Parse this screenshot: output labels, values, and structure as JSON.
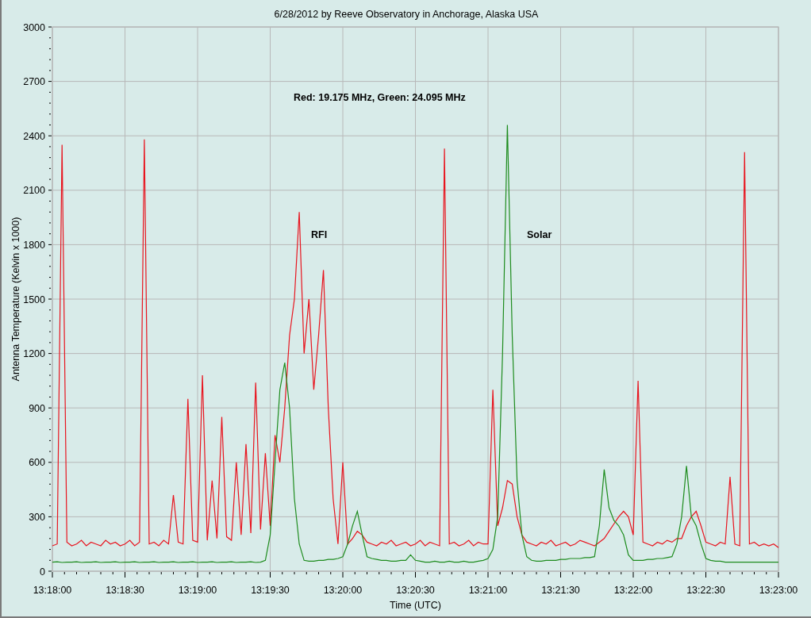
{
  "chart": {
    "chart_data": {
      "type": "line",
      "title": "6/28/2012  by  Reeve Observatory  in  Anchorage, Alaska  USA",
      "xlabel": "Time (UTC)",
      "ylabel": "Antenna Temperature (Kelvin x 1000)",
      "categories": [
        "13:18:00",
        null,
        null,
        null,
        null,
        null,
        null,
        null,
        null,
        null,
        null,
        null,
        null,
        null,
        null,
        "13:18:30",
        null,
        null,
        null,
        null,
        null,
        null,
        null,
        null,
        null,
        null,
        null,
        null,
        null,
        null,
        "13:19:00",
        null,
        null,
        null,
        null,
        null,
        null,
        null,
        null,
        null,
        null,
        null,
        null,
        null,
        null,
        "13:19:30",
        null,
        null,
        null,
        null,
        null,
        null,
        null,
        null,
        null,
        null,
        null,
        null,
        null,
        null,
        "13:20:00",
        null,
        null,
        null,
        null,
        null,
        null,
        null,
        null,
        null,
        null,
        null,
        null,
        null,
        null,
        "13:20:30",
        null,
        null,
        null,
        null,
        null,
        null,
        null,
        null,
        null,
        null,
        null,
        null,
        null,
        null,
        "13:21:00",
        null,
        null,
        null,
        null,
        null,
        null,
        null,
        null,
        null,
        null,
        null,
        null,
        null,
        null,
        "13:21:30",
        null,
        null,
        null,
        null,
        null,
        null,
        null,
        null,
        null,
        null,
        null,
        null,
        null,
        null,
        "13:22:00",
        null,
        null,
        null,
        null,
        null,
        null,
        null,
        null,
        null,
        null,
        null,
        null,
        null,
        null,
        "13:22:30",
        null,
        null,
        null,
        null,
        null,
        null,
        null,
        null,
        null,
        null,
        null,
        null,
        null,
        null,
        "13:23:00"
      ],
      "ylim": [
        0,
        3000
      ],
      "grid": true,
      "yticks": [
        0,
        300,
        600,
        900,
        1200,
        1500,
        1800,
        2100,
        2400,
        2700,
        3000
      ],
      "series": [
        {
          "color": "#e8141e",
          "values": [
            140,
            150,
            2350,
            160,
            140,
            150,
            170,
            140,
            160,
            150,
            140,
            170,
            150,
            160,
            140,
            150,
            170,
            140,
            160,
            2380,
            150,
            160,
            140,
            170,
            150,
            420,
            160,
            150,
            950,
            170,
            160,
            1080,
            170,
            500,
            180,
            850,
            190,
            170,
            600,
            200,
            700,
            210,
            1040,
            230,
            650,
            250,
            750,
            600,
            900,
            1300,
            1500,
            1980,
            1200,
            1500,
            1000,
            1300,
            1660,
            900,
            400,
            150,
            600,
            150,
            180,
            220,
            200,
            160,
            150,
            140,
            160,
            150,
            170,
            140,
            150,
            160,
            140,
            150,
            170,
            140,
            160,
            150,
            140,
            2330,
            150,
            160,
            140,
            150,
            170,
            140,
            160,
            150,
            150,
            1000,
            250,
            350,
            500,
            480,
            300,
            200,
            160,
            150,
            140,
            160,
            150,
            170,
            140,
            150,
            160,
            140,
            150,
            170,
            160,
            150,
            140,
            160,
            180,
            220,
            260,
            300,
            330,
            300,
            200,
            1050,
            160,
            150,
            140,
            160,
            150,
            170,
            160,
            180,
            180,
            250,
            300,
            330,
            250,
            160,
            150,
            140,
            160,
            150,
            520,
            150,
            140,
            2310,
            150,
            160,
            140,
            150,
            140,
            150,
            130
          ]
        },
        {
          "color": "#1e8c1e",
          "values": [
            50,
            52,
            48,
            50,
            50,
            52,
            48,
            50,
            50,
            52,
            48,
            50,
            50,
            52,
            48,
            50,
            50,
            52,
            48,
            50,
            50,
            52,
            48,
            50,
            50,
            52,
            48,
            50,
            50,
            52,
            48,
            50,
            50,
            52,
            48,
            50,
            50,
            52,
            48,
            50,
            50,
            52,
            48,
            50,
            60,
            200,
            600,
            1000,
            1150,
            900,
            400,
            150,
            60,
            55,
            55,
            60,
            60,
            65,
            65,
            70,
            80,
            150,
            250,
            330,
            200,
            80,
            70,
            65,
            60,
            60,
            55,
            55,
            60,
            60,
            90,
            60,
            55,
            50,
            50,
            55,
            50,
            50,
            55,
            50,
            50,
            55,
            50,
            50,
            55,
            60,
            70,
            120,
            300,
            1200,
            2460,
            1300,
            500,
            200,
            80,
            60,
            55,
            55,
            60,
            60,
            60,
            65,
            65,
            70,
            70,
            70,
            75,
            75,
            80,
            250,
            560,
            350,
            280,
            250,
            200,
            90,
            60,
            60,
            60,
            65,
            65,
            70,
            70,
            75,
            80,
            150,
            300,
            580,
            300,
            250,
            150,
            70,
            60,
            55,
            55,
            50,
            50,
            50,
            50,
            50,
            50,
            50,
            50,
            50,
            50,
            50,
            50
          ]
        }
      ],
      "annotations": [
        "Red: 19.175 MHz, Green: 24.095 MHz",
        "RFI",
        "Solar"
      ]
    }
  }
}
